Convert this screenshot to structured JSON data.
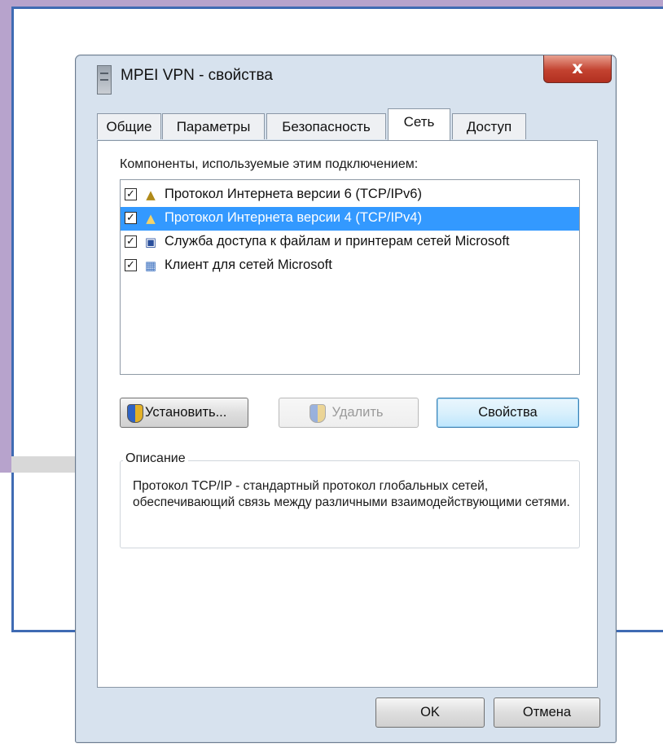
{
  "window": {
    "title": "MPEI VPN - свойства",
    "close_label": "x"
  },
  "tabs": [
    {
      "label": "Общие"
    },
    {
      "label": "Параметры"
    },
    {
      "label": "Безопасность"
    },
    {
      "label": "Сеть",
      "active": true
    },
    {
      "label": "Доступ"
    }
  ],
  "components": {
    "label": "Компоненты, используемые этим подключением:",
    "items": [
      {
        "label": "Протокол Интернета версии 6 (TCP/IPv6)",
        "checked": true,
        "icon": "network-protocol-icon"
      },
      {
        "label": "Протокол Интернета версии 4 (TCP/IPv4)",
        "checked": true,
        "selected": true,
        "icon": "network-protocol-icon"
      },
      {
        "label": "Служба доступа к файлам и принтерам сетей Microsoft",
        "checked": true,
        "icon": "file-printer-service-icon"
      },
      {
        "label": "Клиент для сетей Microsoft",
        "checked": true,
        "icon": "network-client-icon"
      }
    ]
  },
  "buttons": {
    "install": "Установить...",
    "remove": "Удалить",
    "properties": "Свойства",
    "ok": "OK",
    "cancel": "Отмена"
  },
  "description": {
    "title": "Описание",
    "text": "Протокол TCP/IP - стандартный протокол глобальных сетей, обеспечивающий связь между различными взаимодействующими сетями."
  },
  "colors": {
    "selection": "#3399ff",
    "frame_blue": "#3f6bb3",
    "frame_purple": "#b7a3cc"
  }
}
